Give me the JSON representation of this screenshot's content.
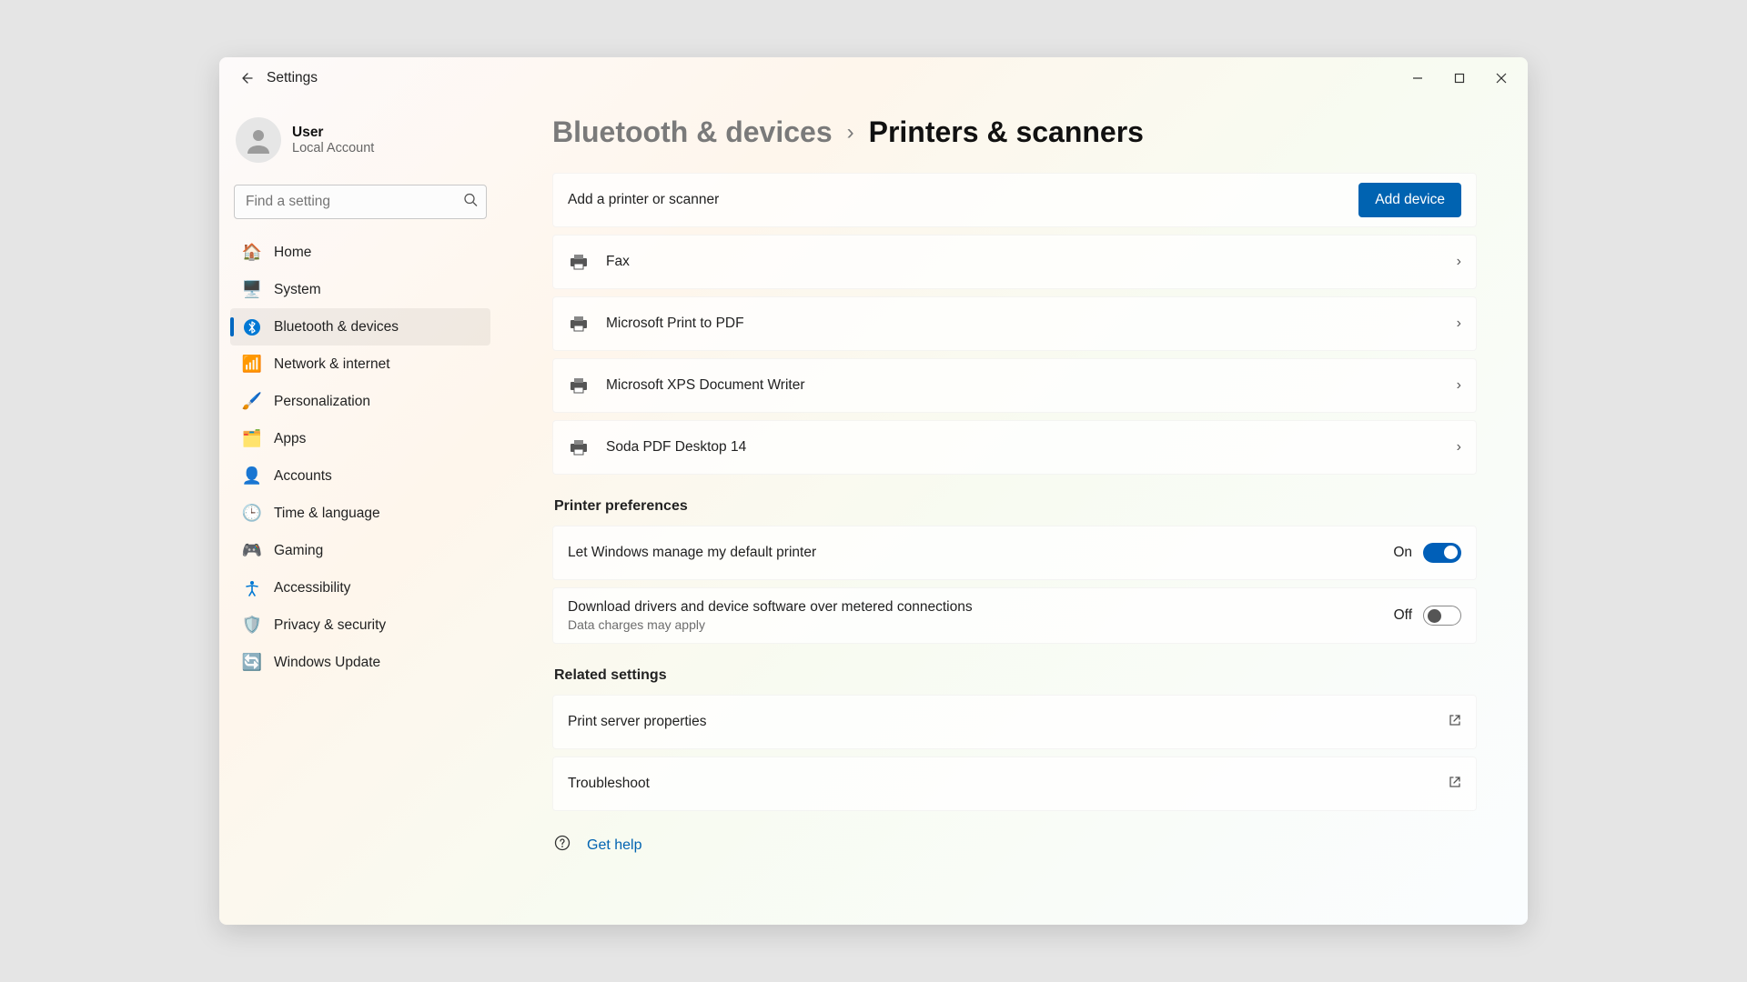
{
  "titlebar": {
    "back_aria": "Back",
    "title": "Settings"
  },
  "profile": {
    "name": "User",
    "subtitle": "Local Account"
  },
  "search": {
    "placeholder": "Find a setting"
  },
  "nav": {
    "items": [
      {
        "label": "Home"
      },
      {
        "label": "System"
      },
      {
        "label": "Bluetooth & devices"
      },
      {
        "label": "Network & internet"
      },
      {
        "label": "Personalization"
      },
      {
        "label": "Apps"
      },
      {
        "label": "Accounts"
      },
      {
        "label": "Time & language"
      },
      {
        "label": "Gaming"
      },
      {
        "label": "Accessibility"
      },
      {
        "label": "Privacy & security"
      },
      {
        "label": "Windows Update"
      }
    ],
    "active_index": 2
  },
  "breadcrumb": {
    "parent": "Bluetooth & devices",
    "current": "Printers & scanners"
  },
  "add_printer": {
    "label": "Add a printer or scanner",
    "button": "Add device"
  },
  "printers": [
    {
      "name": "Fax"
    },
    {
      "name": "Microsoft Print to PDF"
    },
    {
      "name": "Microsoft XPS Document Writer"
    },
    {
      "name": "Soda PDF Desktop 14"
    }
  ],
  "sections": {
    "preferences_title": "Printer preferences",
    "related_title": "Related settings"
  },
  "preferences": {
    "default_printer": {
      "label": "Let Windows manage my default printer",
      "state": "On",
      "on": true
    },
    "metered": {
      "label": "Download drivers and device software over metered connections",
      "sub": "Data charges may apply",
      "state": "Off",
      "on": false
    }
  },
  "related": [
    {
      "label": "Print server properties"
    },
    {
      "label": "Troubleshoot"
    }
  ],
  "help": {
    "label": "Get help"
  },
  "colors": {
    "accent": "#0063b1"
  }
}
